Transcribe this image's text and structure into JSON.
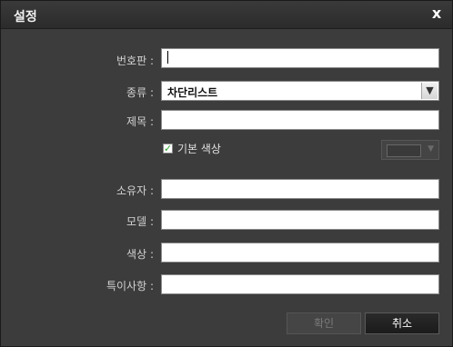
{
  "dialog": {
    "title": "설정",
    "close_glyph": "x",
    "close_icon": "close-icon"
  },
  "form": {
    "plate_label": "번호판 :",
    "plate_value": "",
    "type_label": "종류 :",
    "type_value": "차단리스트",
    "type_arrow": "chevron-down-icon",
    "title_label": "제목 :",
    "title_value": "",
    "default_color_label": "기본 색상",
    "default_color_checked": true,
    "owner_label": "소유자 :",
    "owner_value": "",
    "model_label": "모델 :",
    "model_value": "",
    "color_label": "색상 :",
    "color_value": "",
    "notes_label": "특이사항 :",
    "notes_value": ""
  },
  "buttons": {
    "ok_label": "확인",
    "cancel_label": "취소"
  },
  "colors": {
    "dialog_bg": "#3c3c3c",
    "title_bg": "#2b2b2b",
    "checkbox_check": "#2aa42a"
  }
}
